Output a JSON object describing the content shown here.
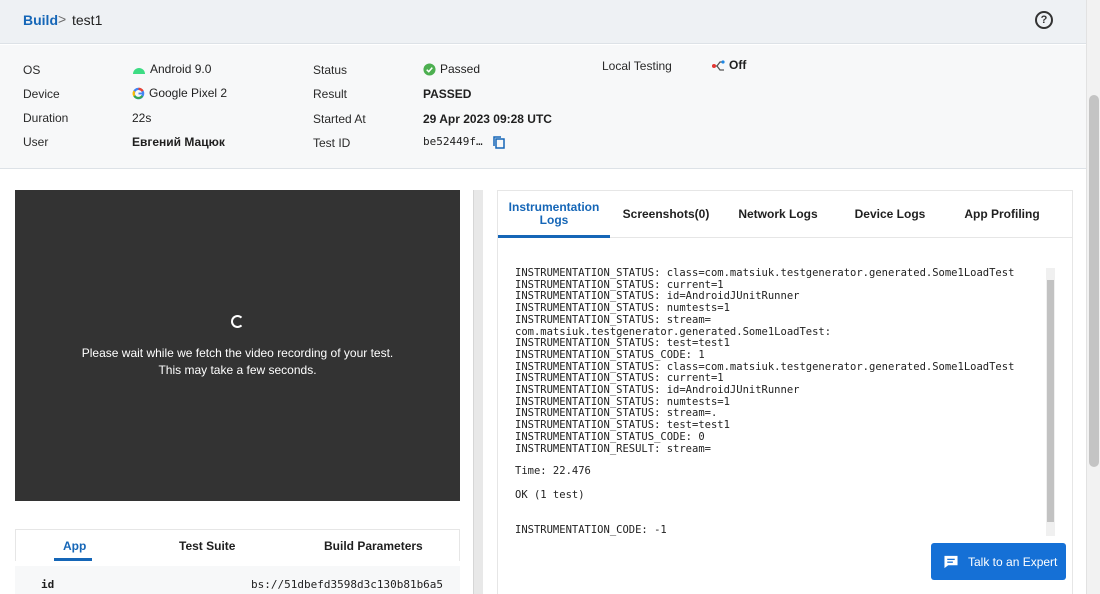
{
  "breadcrumb": {
    "root": "Build",
    "separator": ">",
    "current": "test1"
  },
  "info": {
    "os": {
      "label": "OS",
      "value": "Android 9.0"
    },
    "device": {
      "label": "Device",
      "value": "Google Pixel 2"
    },
    "duration": {
      "label": "Duration",
      "value": "22s"
    },
    "user": {
      "label": "User",
      "value": "Евгений Мацюк"
    },
    "status": {
      "label": "Status",
      "value": "Passed"
    },
    "result": {
      "label": "Result",
      "value": "PASSED"
    },
    "started_at": {
      "label": "Started At",
      "value": "29 Apr 2023 09:28 UTC"
    },
    "test_id": {
      "label": "Test ID",
      "value": "be52449f…"
    },
    "local_testing": {
      "label": "Local Testing",
      "value": "Off"
    }
  },
  "video": {
    "message_line1": "Please wait while we fetch the video recording of your test.",
    "message_line2": "This may take a few seconds."
  },
  "app_tabs": [
    "App",
    "Test Suite",
    "Build Parameters"
  ],
  "app_details": {
    "id_label": "id",
    "id_value": "bs://51dbefd3598d3c130b81b6a5"
  },
  "log_tabs": [
    {
      "label": "Instrumentation Logs",
      "label_line1": "Instrumentation",
      "label_line2": "Logs"
    },
    {
      "label": "Screenshots(0)"
    },
    {
      "label": "Network Logs"
    },
    {
      "label": "Device Logs"
    },
    {
      "label": "App Profiling"
    }
  ],
  "logs": [
    "INSTRUMENTATION_STATUS: class=com.matsiuk.testgenerator.generated.Some1LoadTest",
    "INSTRUMENTATION_STATUS: current=1",
    "INSTRUMENTATION_STATUS: id=AndroidJUnitRunner",
    "INSTRUMENTATION_STATUS: numtests=1",
    "INSTRUMENTATION_STATUS: stream=",
    "com.matsiuk.testgenerator.generated.Some1LoadTest:",
    "INSTRUMENTATION_STATUS: test=test1",
    "INSTRUMENTATION_STATUS_CODE: 1",
    "INSTRUMENTATION_STATUS: class=com.matsiuk.testgenerator.generated.Some1LoadTest",
    "INSTRUMENTATION_STATUS: current=1",
    "INSTRUMENTATION_STATUS: id=AndroidJUnitRunner",
    "INSTRUMENTATION_STATUS: numtests=1",
    "INSTRUMENTATION_STATUS: stream=.",
    "INSTRUMENTATION_STATUS: test=test1",
    "INSTRUMENTATION_STATUS_CODE: 0",
    "INSTRUMENTATION_RESULT: stream=",
    "Time: 22.476",
    "OK (1 test)",
    "INSTRUMENTATION_CODE: -1"
  ],
  "expert_button": {
    "label": "Talk to an Expert"
  },
  "colors": {
    "accent": "#1566b7",
    "success": "#4caf50",
    "video_bg": "#333333",
    "cta": "#1570d6"
  },
  "icons": {
    "os": "android-icon",
    "device": "google-icon",
    "status": "check-circle-icon",
    "test_id": "copy-icon",
    "local_testing": "local-testing-icon",
    "help": "help-icon",
    "video": "loading-spinner-icon",
    "expert": "chat-icon"
  }
}
